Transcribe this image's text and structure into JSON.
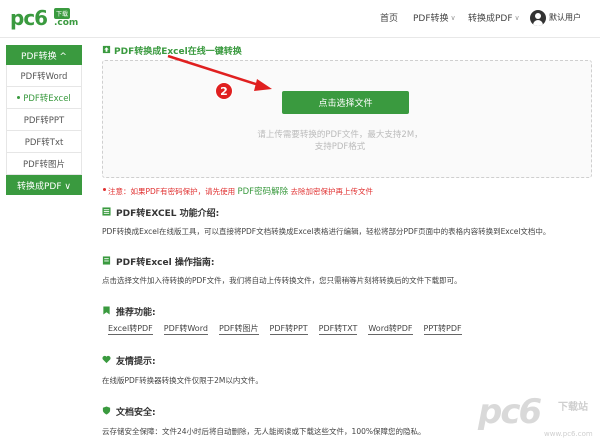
{
  "header": {
    "logo_main": "pc6",
    "logo_tag": "下载",
    "logo_com": ".com",
    "nav": [
      {
        "label": "首页",
        "caret": false
      },
      {
        "label": "PDF转换",
        "caret": true
      },
      {
        "label": "转换成PDF",
        "caret": true
      }
    ],
    "user_label": "默认用户"
  },
  "sidebar": {
    "head_label": "PDF转换 ^",
    "items": [
      "PDF转Word",
      "PDF转Excel",
      "PDF转PPT",
      "PDF转Txt",
      "PDF转图片"
    ],
    "active_index": 1,
    "footer_label": "转换成PDF ∨"
  },
  "upload": {
    "title": "PDF转换成Excel在线一键转换",
    "button_label": "点击选择文件",
    "hint_line1": "请上传需要转换的PDF文件，最大支持2M，",
    "hint_line2": "支持PDF格式",
    "badge": "2"
  },
  "notice": {
    "prefix": "注意：如果PDF有密码保护，请先使用",
    "link": "PDF密码解除",
    "suffix": "去除加密保护再上传文件"
  },
  "sections": {
    "intro_title": "PDF转EXCEL 功能介绍:",
    "intro_text": "PDF转换成Excel在线版工具，可以直接将PDF文档转换成Excel表格进行编辑，轻松将部分PDF页面中的表格内容转换到Excel文档中。",
    "guide_title": "PDF转Excel 操作指南:",
    "guide_text": "点击选择文件加入待转换的PDF文件，我们将自动上传转换文件，您只需稍等片刻将转换后的文件下载即可。",
    "recommend_title": "推荐功能:",
    "recommend_links": [
      "Excel转PDF",
      "PDF转Word",
      "PDF转图片",
      "PDF转PPT",
      "PDF转TXT",
      "Word转PDF",
      "PPT转PDF"
    ],
    "tips_title": "友情提示:",
    "tips_text": "在线版PDF转换器转换文件仅限于2M以内文件。",
    "security_title": "文档安全:",
    "security_text": "云存储安全保障：文件24小时后将自动删除，无人能阅读或下载这些文件，100%保障您的隐私。"
  },
  "watermark": {
    "big": "pc6",
    "cn": "下载站",
    "url": "www.pc6.com"
  },
  "colors": {
    "brand_green": "#3a9a3f",
    "alert_red": "#e02020"
  }
}
